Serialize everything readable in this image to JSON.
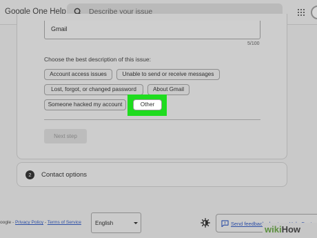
{
  "header": {
    "brand": "Google One Help",
    "search_placeholder": "Describe your issue"
  },
  "form": {
    "textbox_value": "Gmail",
    "char_counter": "5/100",
    "question": "Choose the best description of this issue:",
    "options": [
      "Account access issues",
      "Unable to send or receive messages",
      "Lost, forgot, or changed password",
      "About Gmail",
      "Someone hacked my account",
      "Other"
    ],
    "selected_option": "Other",
    "next_button": "Next step"
  },
  "contact": {
    "step_number": "2",
    "label": "Contact options"
  },
  "footer": {
    "prefix": "oogle - ",
    "privacy": "Privacy Policy",
    "sep": " - ",
    "terms": "Terms of Service",
    "language": "English",
    "feedback": "Send feedback about our Help Cent"
  },
  "watermark": {
    "part1": "wiki",
    "part2": "How"
  },
  "icons": [
    "search-icon",
    "apps-grid-icon",
    "avatar-icon",
    "dropdown-caret-icon",
    "theme-toggle-icon",
    "feedback-icon"
  ]
}
